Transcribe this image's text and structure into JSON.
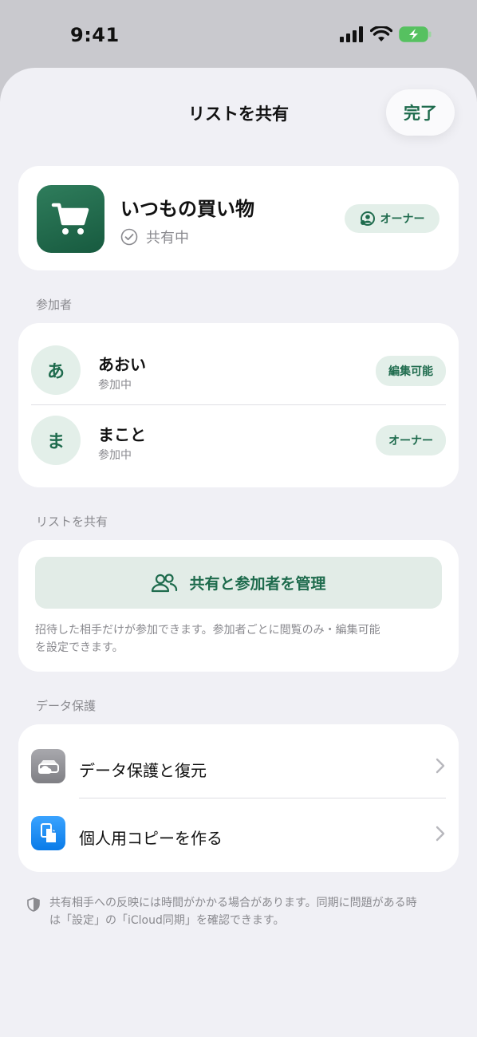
{
  "status_bar": {
    "time": "9:41"
  },
  "header": {
    "title": "リストを共有",
    "done_label": "完了"
  },
  "list": {
    "name": "いつもの買い物",
    "status": "共有中",
    "role_badge": "オーナー"
  },
  "participants": {
    "section_label": "参加者",
    "items": [
      {
        "initial": "あ",
        "name": "あおい",
        "status": "参加中",
        "badge": "編集可能"
      },
      {
        "initial": "ま",
        "name": "まこと",
        "status": "参加中",
        "badge": "オーナー"
      }
    ]
  },
  "share": {
    "section_label": "リストを共有",
    "manage_label": "共有と参加者を管理",
    "note_line1": "招待した相手だけが参加できます。参加者ごとに閲覧のみ・編集可能",
    "note_line2": "を設定できます。"
  },
  "protection": {
    "section_label": "データ保護",
    "items": [
      {
        "label": "データ保護と復元",
        "icon": "cloud-drive-icon",
        "color": "#8e8e93"
      },
      {
        "label": "個人用コピーを作る",
        "icon": "copy-document-icon",
        "color": "#1a8cf0"
      }
    ]
  },
  "footer": {
    "line1": "共有相手への反映には時間がかかる場合があります。同期に問題がある時",
    "line2": "は「設定」の「iCloud同期」を確認できます。"
  },
  "colors": {
    "accent": "#1e6b4d",
    "badge_bg": "#e3efe9",
    "sheet_bg": "#f0f0f5"
  }
}
